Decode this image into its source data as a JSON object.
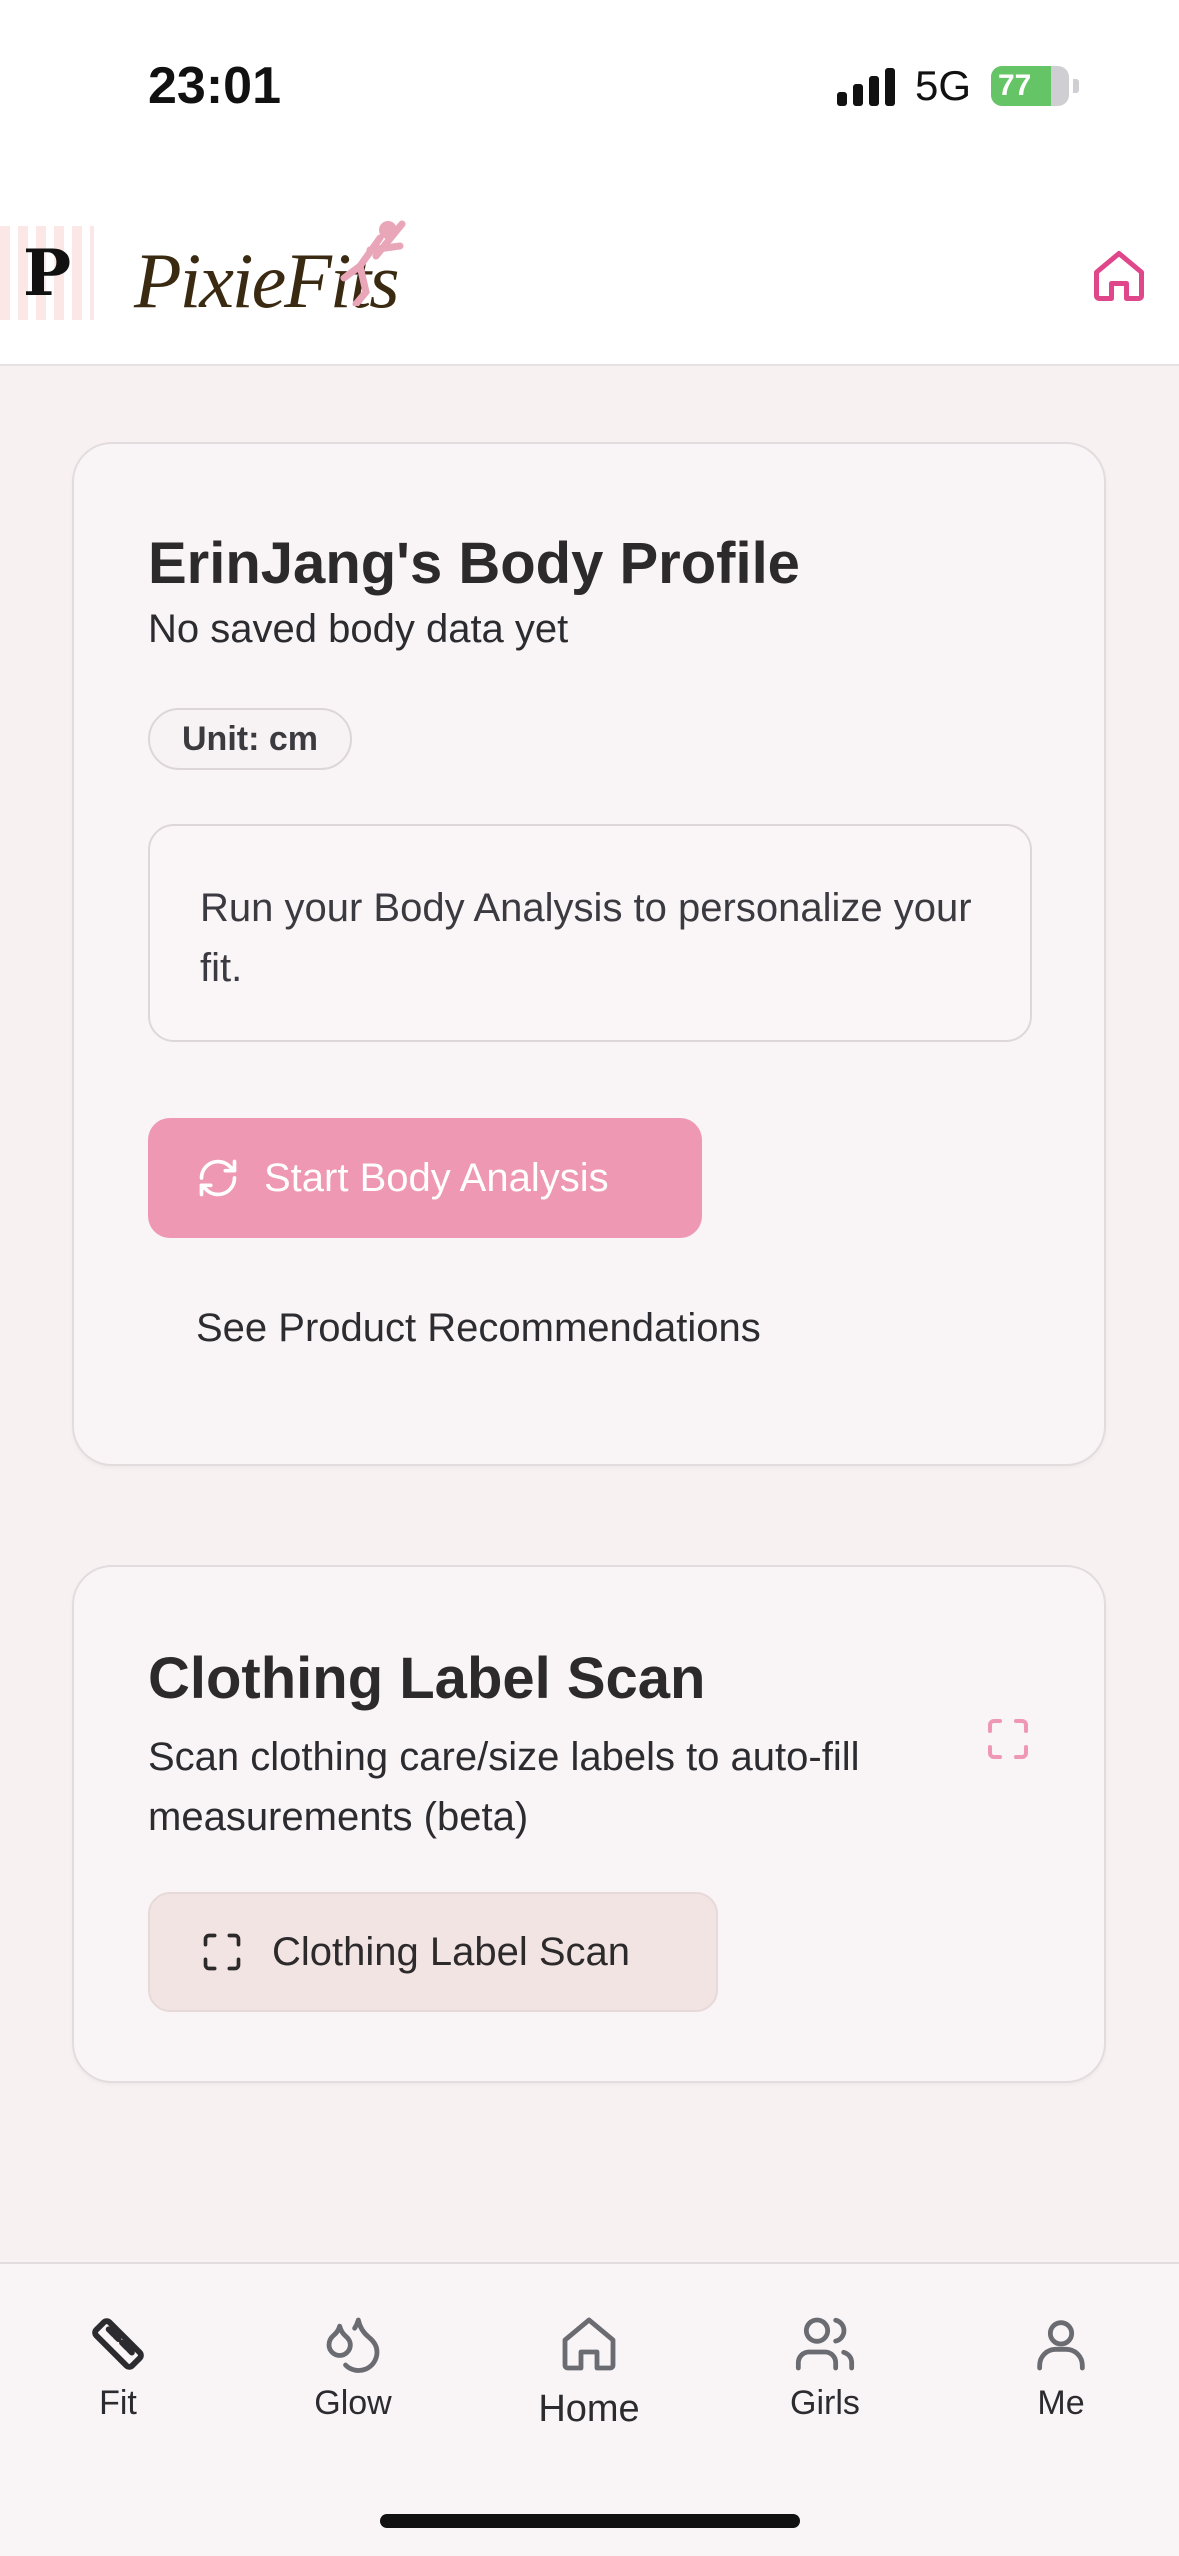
{
  "status_bar": {
    "time": "23:01",
    "network": "5G",
    "battery": "77",
    "battery_level": 0.77
  },
  "header": {
    "logo_letter": "P",
    "logo_text": "PixieFits",
    "home_icon": "home-icon"
  },
  "profile_card": {
    "title": "ErinJang's Body Profile",
    "subtitle": "No saved body data yet",
    "unit_chip": "Unit: cm",
    "info_text": "Run your Body Analysis to personalize your fit.",
    "start_button": "Start Body Analysis",
    "start_icon": "refresh-icon",
    "recommendations_link": "See Product Recommendations"
  },
  "scan_card": {
    "title": "Clothing Label Scan",
    "description": "Scan clothing care/size labels to auto-fill measurements (beta)",
    "scan_icon": "scan-icon",
    "scan_button": "Clothing Label Scan"
  },
  "bottom_nav": {
    "items": [
      {
        "label": "Fit",
        "icon": "ruler-icon"
      },
      {
        "label": "Glow",
        "icon": "droplets-icon"
      },
      {
        "label": "Home",
        "icon": "home-icon"
      },
      {
        "label": "Girls",
        "icon": "users-icon"
      },
      {
        "label": "Me",
        "icon": "user-icon"
      }
    ]
  },
  "colors": {
    "accent": "#ee98b4",
    "brand_pink": "#e0468a",
    "background": "#f8f1f2"
  }
}
